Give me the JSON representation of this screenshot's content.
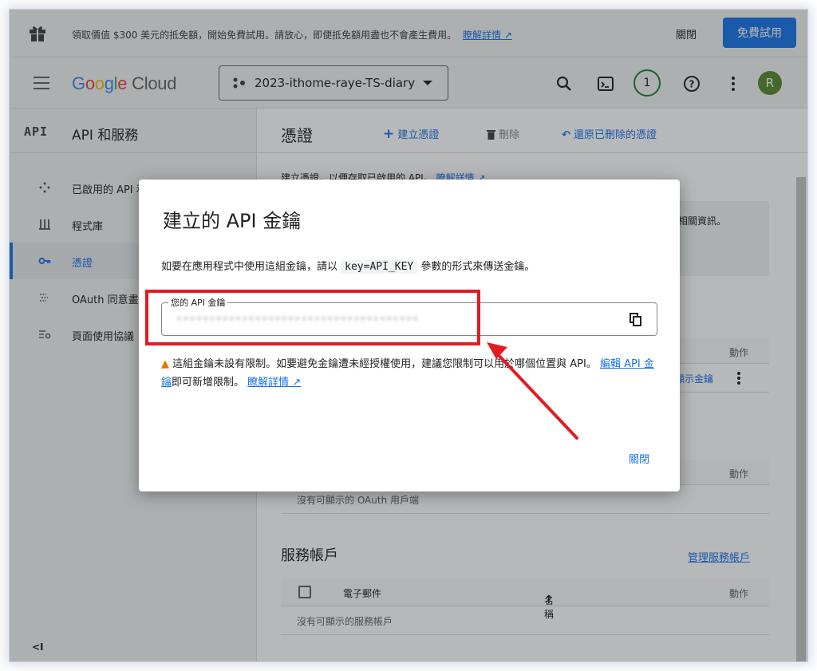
{
  "promo": {
    "message": "領取價值 $300 美元的抵免額，開始免費試用。請放心，即便抵免額用盡也不會產生費用。",
    "learn_more": "瞭解詳情",
    "close_label": "關閉",
    "trial_label": "免費試用"
  },
  "topbar": {
    "logo_google": "Google",
    "logo_cloud": "Cloud",
    "project_name": "2023-ithome-raye-TS-diary",
    "notification_count": "1",
    "avatar_initial": "R"
  },
  "sidebar": {
    "api_logo": "API",
    "title": "API 和服務",
    "items": [
      {
        "label": "已啟用的 API 和服務",
        "icon": "api-diamond-icon"
      },
      {
        "label": "程式庫",
        "icon": "library-icon"
      },
      {
        "label": "憑證",
        "icon": "key-icon"
      },
      {
        "label": "OAuth 同意畫面",
        "icon": "oauth-icon"
      },
      {
        "label": "頁面使用協議",
        "icon": "settings-list-icon"
      }
    ],
    "collapse_label": "<I"
  },
  "main": {
    "title": "憑證",
    "create_label": "建立憑證",
    "delete_label": "刪除",
    "restore_label": "還原已刪除的憑證",
    "description": "建立憑證，以便存取已啟用的 API。",
    "learn_more": "瞭解詳情",
    "info_text": "相關資訊。",
    "api_keys_action_header": "動作",
    "show_key_label": "顯示金鑰",
    "oauth_action_header": "動作",
    "oauth_empty": "沒有可顯示的 OAuth 用戶端",
    "service_accounts_title": "服務帳戶",
    "manage_service_accounts": "管理服務帳戶",
    "sa_col_email": "電子郵件",
    "sa_col_name": "名稱",
    "sa_col_action": "動作",
    "sa_empty": "沒有可顯示的服務帳戶"
  },
  "dialog": {
    "title": "建立的 API 金鑰",
    "instruction_before": "如要在應用程式中使用這組金鑰，請以",
    "instruction_code": "key=API_KEY",
    "instruction_after": "參數的形式來傳送金鑰。",
    "field_label": "您的 API 金鑰",
    "field_value": "•••••••••••••••••••••••••••••••••••••",
    "warning_text": "這組金鑰未設有限制。如要避免金鑰遭未經授權使用，建議您限制可以用於哪個位置與 API。",
    "edit_link": "編輯 API 金鑰",
    "warning_suffix": "即可新增限制。",
    "learn_more": "瞭解詳情",
    "close_label": "關閉"
  },
  "colors": {
    "accent": "#1a73e8",
    "highlight": "#e31b23",
    "warning": "#e37400"
  }
}
